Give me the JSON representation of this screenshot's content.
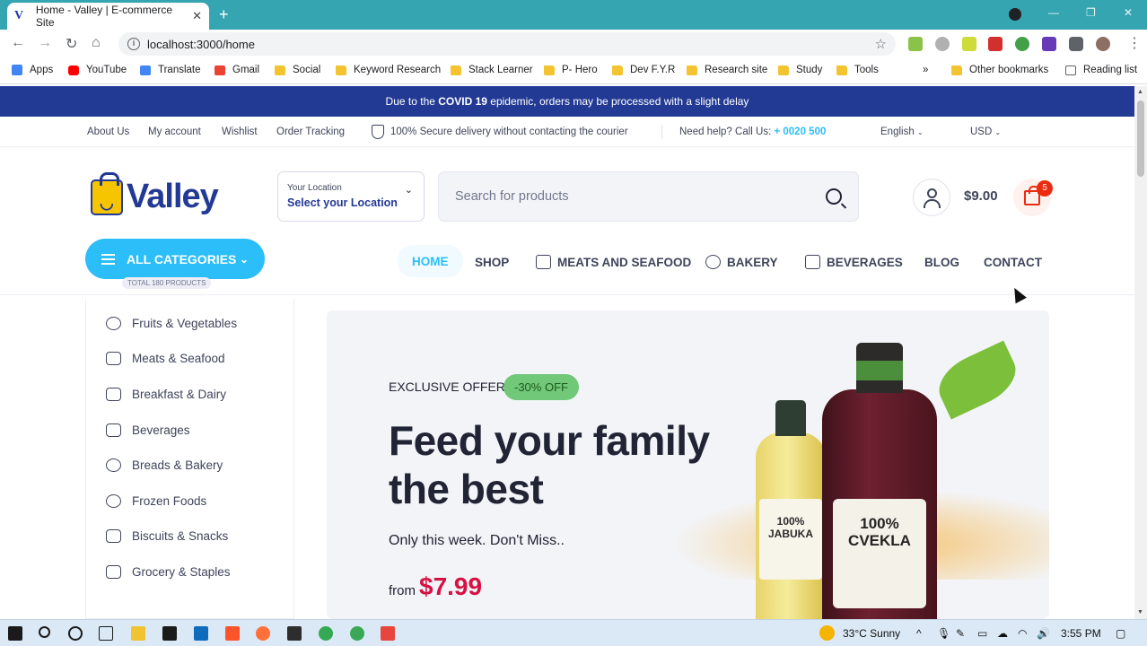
{
  "browser": {
    "tab_title": "Home - Valley | E-commerce Site",
    "tab_favicon": "V",
    "url": "localhost:3000/home",
    "bookmarks": [
      "Apps",
      "YouTube",
      "Translate",
      "Gmail",
      "Social",
      "Keyword Research",
      "Stack Learner",
      "P- Hero",
      "Dev F.Y.R",
      "Research site",
      "Study",
      "Tools"
    ],
    "other_bookmarks": "Other bookmarks",
    "reading_list": "Reading list"
  },
  "announcement": {
    "before": "Due to the ",
    "highlight": "COVID 19",
    "after": " epidemic, orders may be processed with a slight delay"
  },
  "topbar": {
    "links": [
      "About Us",
      "My account",
      "Wishlist",
      "Order Tracking"
    ],
    "secure": "100% Secure delivery without contacting the courier",
    "help": "Need help? Call Us:",
    "phone": "+ 0020 500",
    "language": "English",
    "currency": "USD"
  },
  "header": {
    "logo_text": "Valley",
    "location_label": "Your Location",
    "location_value": "Select your Location",
    "search_placeholder": "Search for products",
    "cart_total": "$9.00",
    "cart_count": "5"
  },
  "categories_button": {
    "label": "ALL CATEGORIES",
    "total": "TOTAL 180 PRODUCTS"
  },
  "nav": [
    "HOME",
    "SHOP",
    "MEATS AND SEAFOOD",
    "BAKERY",
    "BEVERAGES",
    "BLOG",
    "CONTACT"
  ],
  "sidebar": [
    "Fruits & Vegetables",
    "Meats & Seafood",
    "Breakfast & Dairy",
    "Beverages",
    "Breads & Bakery",
    "Frozen Foods",
    "Biscuits & Snacks",
    "Grocery & Staples"
  ],
  "hero": {
    "eyebrow": "Exclusive Offer",
    "discount": "-30% OFF",
    "title": "Feed your family the best",
    "subtitle": "Only this week. Don't Miss..",
    "price_prefix": "from",
    "price": "$7.99",
    "bottle1_label": "100% JABUKA",
    "bottle2_label": "100% CVEKLA"
  },
  "taskbar": {
    "weather": "33°C  Sunny",
    "time": "3:55 PM"
  },
  "colors": {
    "accent": "#2bbef9",
    "brand": "#233a95",
    "price": "#d51243",
    "offer": "#71c878",
    "cart": "#ea2b0f"
  }
}
